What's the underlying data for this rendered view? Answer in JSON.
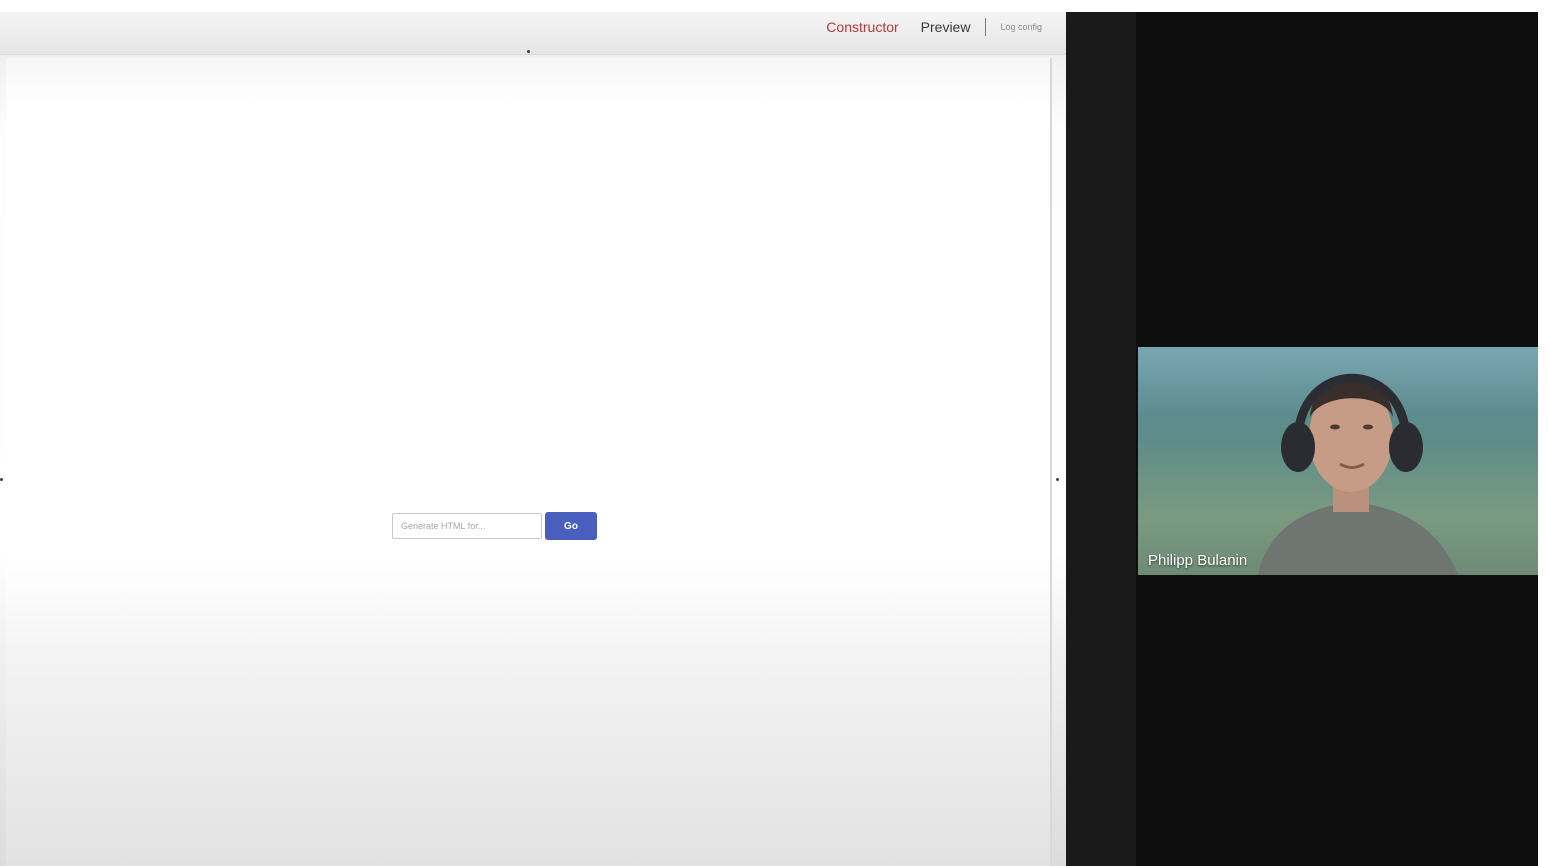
{
  "header": {
    "nav": {
      "constructor": "Constructor",
      "preview": "Preview",
      "log_config": "Log config"
    }
  },
  "generator": {
    "input_placeholder": "Generate HTML for...",
    "go_label": "Go",
    "accent_color": "#4a5fbd"
  },
  "video_call": {
    "participant_name": "Philipp Bulanin"
  }
}
